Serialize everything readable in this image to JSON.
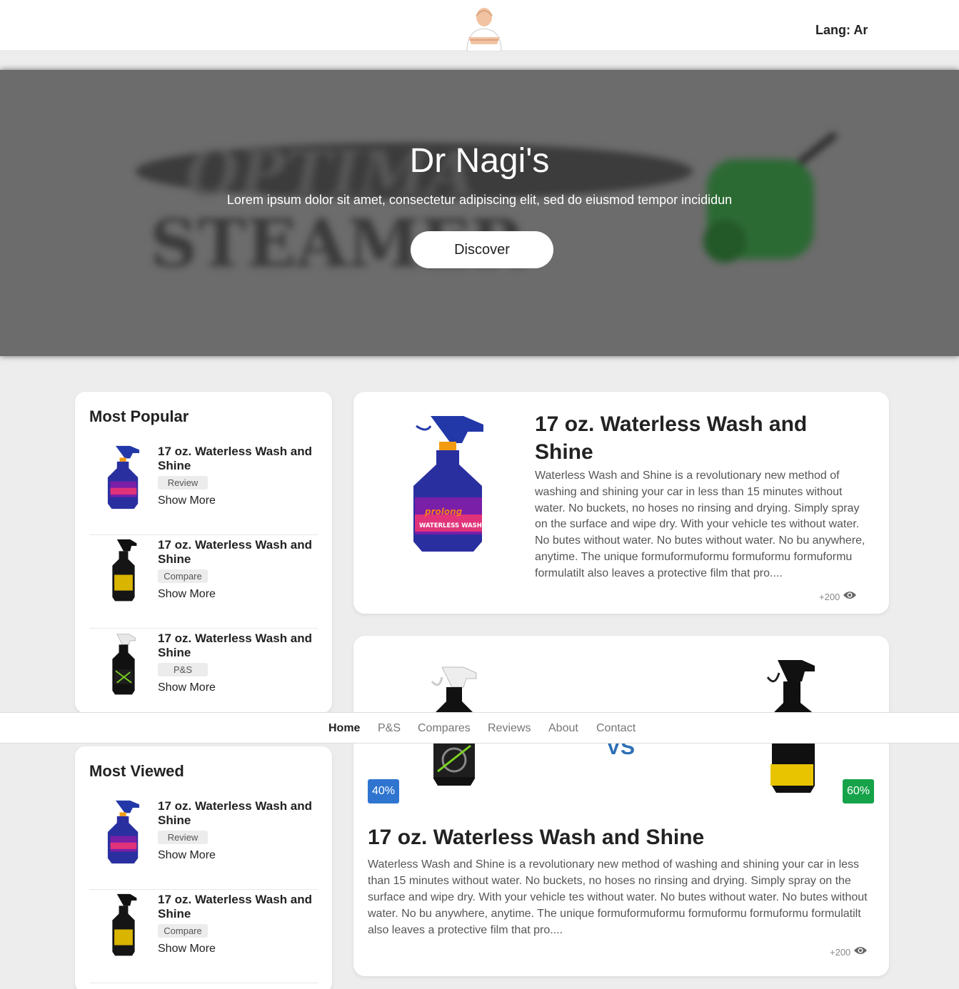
{
  "header": {
    "lang_label": "Lang: Ar"
  },
  "hero": {
    "title": "Dr Nagi's",
    "subtitle": "Lorem ipsum dolor sit amet, consectetur adipiscing elit, sed do eiusmod tempor incididun",
    "button_label": "Discover",
    "background_text": [
      "OPTIMA",
      "STEAMER"
    ]
  },
  "most_popular": {
    "heading": "Most Popular",
    "items": [
      {
        "title": "17 oz. Waterless Wash and Shine",
        "tag": "Review",
        "more": "Show More"
      },
      {
        "title": "17 oz. Waterless Wash and Shine",
        "tag": "Compare",
        "more": "Show More"
      },
      {
        "title": "17 oz. Waterless Wash and Shine",
        "tag": "P&S",
        "more": "Show More"
      }
    ]
  },
  "most_viewed": {
    "heading": "Most Viewed",
    "items": [
      {
        "title": "17 oz. Waterless Wash and Shine",
        "tag": "Review",
        "more": "Show More"
      },
      {
        "title": "17 oz. Waterless Wash and Shine",
        "tag": "Compare",
        "more": "Show More"
      }
    ]
  },
  "review_card": {
    "title": "17 oz. Waterless Wash and Shine",
    "description": "Waterless Wash and Shine is a revolutionary new method of washing and shining your car in less than 15 minutes without water. No buckets, no hoses no rinsing and drying. Simply spray on the surface and wipe dry. With your vehicle tes without water. No butes without water. No butes without water. No bu anywhere, anytime. The unique formuformuformu formuformu formuformu formulatilt also leaves a protective film that pro....",
    "views": "+200",
    "product_label_top": "prolong",
    "product_label_main": "WATERLESS WASH & SHINE"
  },
  "compare_card": {
    "title": "17 oz. Waterless Wash and Shine",
    "description": "Waterless Wash and Shine is a revolutionary new method of washing and shining your car in less than 15 minutes without water. No buckets, no hoses no rinsing and drying. Simply spray on the surface and wipe dry. With your vehicle tes without water. No butes without water. No butes without water. No bu anywhere, anytime. The unique formuformuformu formuformu formuformu formulatilt also leaves a protective film that pro....",
    "views": "+200",
    "vs_label": "VS",
    "left_percent": "40%",
    "right_percent": "60%",
    "left_color": "#2f75d0",
    "right_color": "#16a34a"
  },
  "nav": {
    "items": [
      "Home",
      "P&S",
      "Compares",
      "Reviews",
      "About",
      "Contact"
    ],
    "active": "Home"
  },
  "colors": {
    "page_bg": "#ededed",
    "hero_overlay": "#6c6c6c",
    "accent_blue": "#2c6fb5",
    "bottle_blue": "#2a2fa0"
  }
}
